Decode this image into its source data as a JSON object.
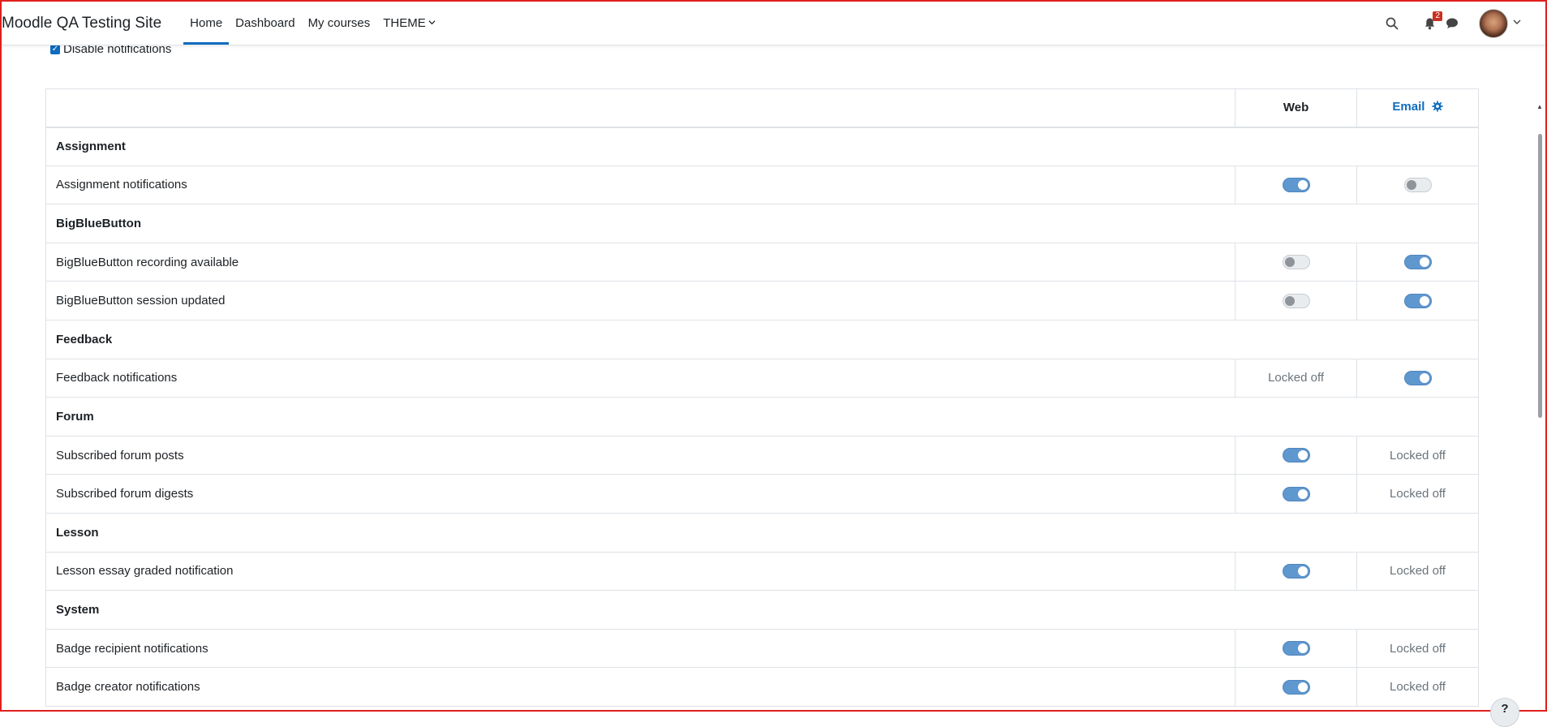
{
  "navbar": {
    "brand": "Moodle QA Testing Site",
    "links": [
      {
        "label": "Home"
      },
      {
        "label": "Dashboard"
      },
      {
        "label": "My courses"
      },
      {
        "label": "THEME"
      }
    ],
    "notification_count": "2"
  },
  "settings": {
    "disable_notifications_label": "Disable notifications",
    "disable_notifications_checked": true
  },
  "table": {
    "headers": {
      "web": "Web",
      "email": "Email"
    },
    "locked_text": "Locked off",
    "sections": [
      {
        "title": "Assignment",
        "rows": [
          {
            "label": "Assignment notifications",
            "web": "on",
            "email": "off"
          }
        ]
      },
      {
        "title": "BigBlueButton",
        "rows": [
          {
            "label": "BigBlueButton recording available",
            "web": "off",
            "email": "on"
          },
          {
            "label": "BigBlueButton session updated",
            "web": "off",
            "email": "on"
          }
        ]
      },
      {
        "title": "Feedback",
        "rows": [
          {
            "label": "Feedback notifications",
            "web": "Locked off",
            "email": "on"
          }
        ]
      },
      {
        "title": "Forum",
        "rows": [
          {
            "label": "Subscribed forum posts",
            "web": "on",
            "email": "Locked off"
          },
          {
            "label": "Subscribed forum digests",
            "web": "on",
            "email": "Locked off"
          }
        ]
      },
      {
        "title": "Lesson",
        "rows": [
          {
            "label": "Lesson essay graded notification",
            "web": "on",
            "email": "Locked off"
          }
        ]
      },
      {
        "title": "System",
        "rows": [
          {
            "label": "Badge recipient notifications",
            "web": "on",
            "email": "Locked off"
          },
          {
            "label": "Badge creator notifications",
            "web": "on",
            "email": "Locked off"
          }
        ]
      }
    ]
  },
  "help": {
    "label": "?"
  },
  "colors": {
    "primary": "#0f6cbf",
    "toggle_on": "#5f97cf",
    "badge": "#ca3120"
  }
}
